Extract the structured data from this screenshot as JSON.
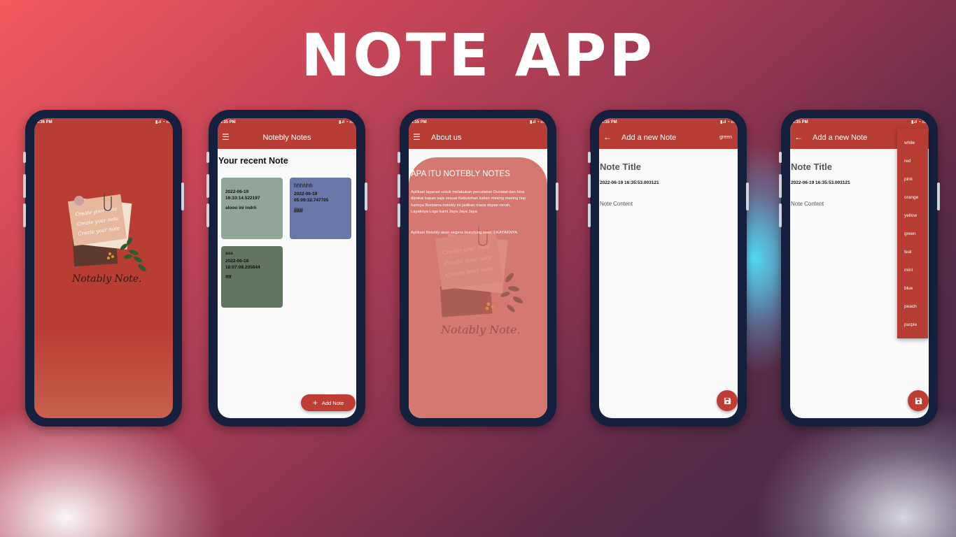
{
  "headline": "NOTE APP",
  "colors": {
    "primary": "#b83d34",
    "splash_bg": "#b83d34",
    "card_green": "#8fa698",
    "card_blue": "#6a78a8",
    "card_dark_green": "#617561",
    "about_panel": "#d47870"
  },
  "phone1": {
    "time": "4:36 PM",
    "logo_text": "Notably Note."
  },
  "phone2": {
    "time": "4:35 PM",
    "app_title": "Notebly Notes",
    "menu_icon": "hamburger-icon",
    "section_heading": "Your recent Note",
    "notes": [
      {
        "title": "",
        "date": "2022-06-19 16:33:14.522197",
        "content": "alooo ini indrii"
      },
      {
        "title": "hhhhhh",
        "date": "2022-06-19 05:09:32.747705",
        "content": "jjjjjjj"
      },
      {
        "title": "sss",
        "date": "2022-06-18 18:07:08.205844",
        "content": "ffff"
      }
    ],
    "fab_label": "Add Note"
  },
  "phone3": {
    "time": "4:35 PM",
    "app_title": "About us",
    "heading": "APA ITU NOTEBLY NOTES",
    "paragraph1": "Aplikasi layanan untuk melakukan percatatan Duniawi dan bisa dipakai kapan saja sesuai Kebutuhan kalian masing masing tiap harinya Bersama notebly ini jadikan masa depan cerah, Layaknya Logo kami Jaya Jaya Jaya",
    "paragraph2": "Aplikasi Notebly akan segera launching soon :) KAYAKNYA",
    "logo_text": "Notably Note."
  },
  "phone4": {
    "time": "4:35 PM",
    "app_title": "Add a new Note",
    "color_selected": "green",
    "note_title": "Note Title",
    "timestamp": "2022-06-19 16:35:53.003121",
    "content_placeholder": "Note Content"
  },
  "phone5": {
    "time": "4:35 PM",
    "app_title": "Add a new Note",
    "note_title": "Note Title",
    "timestamp": "2022-06-19 16:35:53.003121",
    "content_placeholder": "Note Content",
    "color_options": [
      "white",
      "red",
      "pink",
      "orange",
      "yellow",
      "green",
      "teal",
      "mint",
      "blue",
      "peach",
      "purple"
    ]
  }
}
